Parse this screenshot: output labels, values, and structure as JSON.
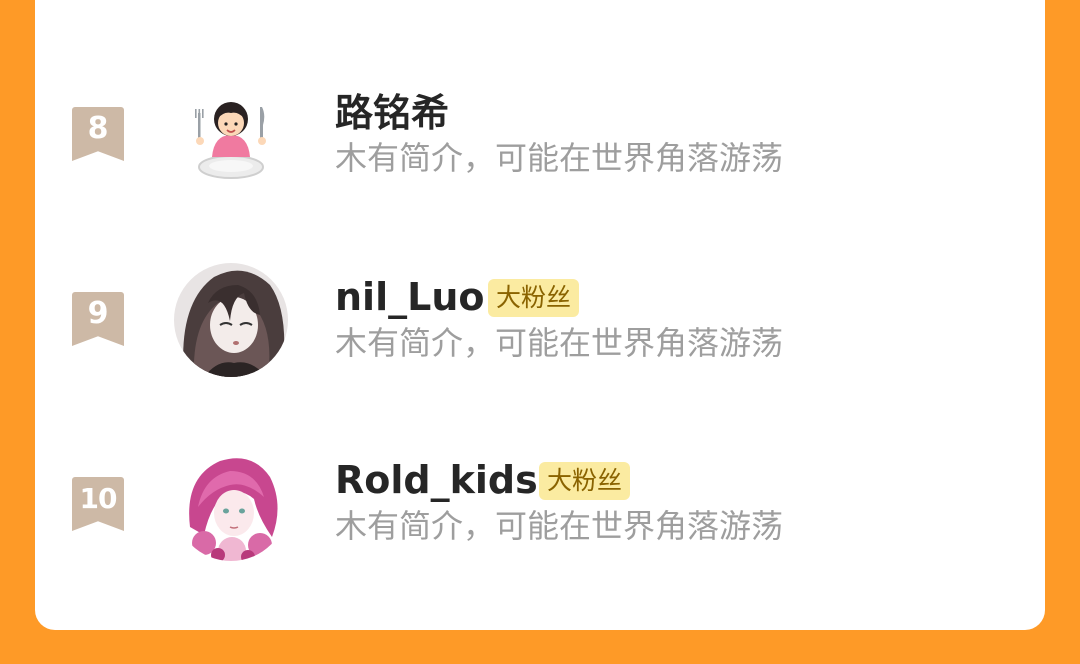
{
  "fans": [
    {
      "rank": "8",
      "name": "路铭希",
      "tag": "",
      "intro": "木有简介，可能在世界角落游荡",
      "avatar_icon": "girl-with-fork-and-knife-icon"
    },
    {
      "rank": "9",
      "name": "nil_Luo",
      "tag": "大粉丝",
      "intro": "木有简介，可能在世界角落游荡",
      "avatar_icon": "anime-girl-avatar"
    },
    {
      "rank": "10",
      "name": "Rold_kids",
      "tag": "大粉丝",
      "intro": "木有简介，可能在世界角落游荡",
      "avatar_icon": "pink-hair-anime-avatar"
    }
  ],
  "colors": {
    "background": "#FE9A27",
    "card": "#ffffff",
    "rank_badge": "#CDB9A6",
    "tag_bg": "#FBEBA1",
    "tag_text": "#8A6300",
    "name_text": "#262626",
    "intro_text": "#9E9E9E"
  }
}
